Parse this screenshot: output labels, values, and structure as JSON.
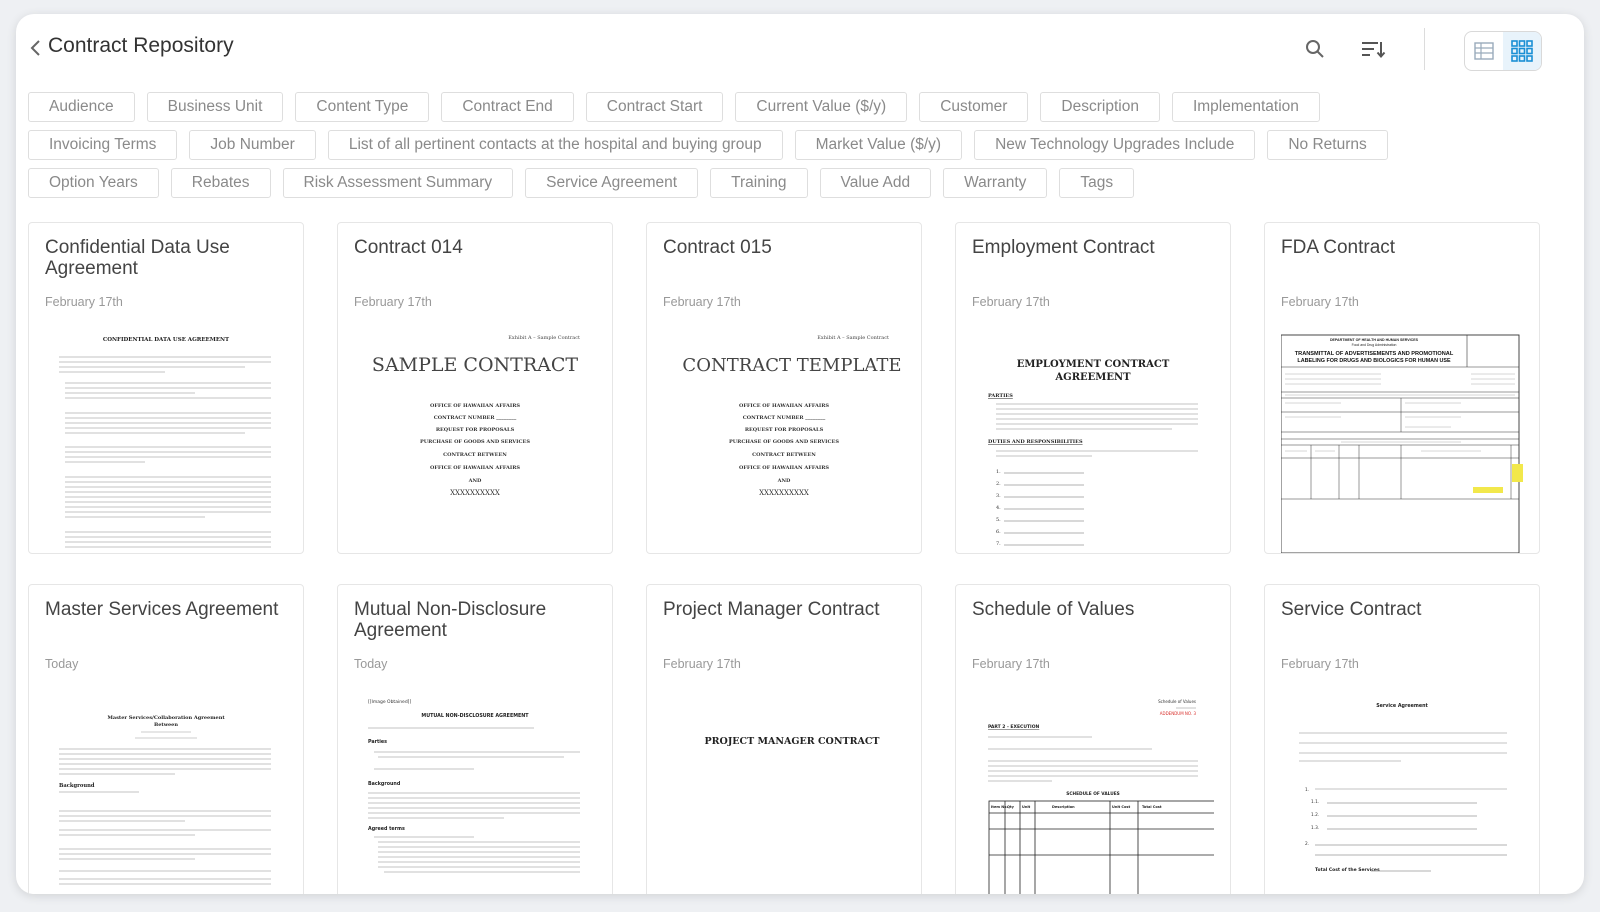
{
  "header": {
    "title": "Contract Repository",
    "icons": [
      "back-chevron-icon",
      "search-icon",
      "sort-icon",
      "table-view-icon",
      "grid-view-icon"
    ],
    "active_view": "grid"
  },
  "filters": {
    "row1": [
      "Audience",
      "Business Unit",
      "Content Type",
      "Contract End",
      "Contract Start",
      "Current Value ($/y)",
      "Customer",
      "Description",
      "Implementation"
    ],
    "row2": [
      "Invoicing Terms",
      "Job Number",
      "List of all pertinent contacts at the hospital and buying group",
      "Market Value ($/y)",
      "New Technology Upgrades Include",
      "No Returns"
    ],
    "row3": [
      "Option Years",
      "Rebates",
      "Risk Assessment Summary",
      "Service Agreement",
      "Training",
      "Value Add",
      "Warranty",
      "Tags"
    ]
  },
  "cards": [
    {
      "title": "Confidential Data Use Agreement",
      "date": "February 17th",
      "heading": "CONFIDENTIAL DATA USE AGREEMENT"
    },
    {
      "title": "Contract 014",
      "date": "February 17th",
      "exhibit": "Exhibit A – Sample Contract",
      "heading": "SAMPLE CONTRACT",
      "lines": [
        "OFFICE OF HAWAIIAN AFFAIRS",
        "CONTRACT NUMBER ________",
        "REQUEST FOR PROPOSALS",
        "PURCHASE OF GOODS AND SERVICES",
        "CONTRACT BETWEEN",
        "OFFICE OF HAWAIIAN AFFAIRS",
        "AND",
        "XXXXXXXXXX"
      ]
    },
    {
      "title": "Contract 015",
      "date": "February 17th",
      "exhibit": "Exhibit A – Sample Contract",
      "heading": "CONTRACT TEMPLATE",
      "lines": [
        "OFFICE OF HAWAIIAN AFFAIRS",
        "CONTRACT NUMBER ________",
        "REQUEST FOR PROPOSALS",
        "PURCHASE OF GOODS AND SERVICES",
        "CONTRACT BETWEEN",
        "OFFICE OF HAWAIIAN AFFAIRS",
        "AND",
        "XXXXXXXXXX"
      ]
    },
    {
      "title": "Employment Contract",
      "date": "February 17th",
      "heading1": "EMPLOYMENT CONTRACT",
      "heading2": "AGREEMENT",
      "section1": "PARTIES",
      "section2": "DUTIES AND RESPONSIBILITIES"
    },
    {
      "title": "FDA Contract",
      "date": "February 17th",
      "dept": "DEPARTMENT OF HEALTH AND HUMAN SERVICES",
      "agency": "Food and Drug Administration",
      "heading1": "TRANSMITTAL OF ADVERTISEMENTS AND PROMOTIONAL",
      "heading2": "LABELING FOR DRUGS AND BIOLOGICS FOR HUMAN USE"
    },
    {
      "title": "Master Services Agreement",
      "date": "Today",
      "heading1": "Master Services/Collaboration Agreement",
      "heading2": "Between",
      "section1": "Background"
    },
    {
      "title": "Mutual Non-Disclosure Agreement",
      "date": "Today",
      "image_tag": "[[Image Obtained]]",
      "heading": "MUTUAL NON-DISCLOSURE AGREEMENT",
      "section1": "Parties",
      "section2": "Background",
      "section3": "Agreed terms"
    },
    {
      "title": "Project Manager Contract",
      "date": "February 17th",
      "heading": "PROJECT MANAGER CONTRACT"
    },
    {
      "title": "Schedule of Values",
      "date": "February 17th",
      "corner1": "Schedule of Values",
      "corner2": "ADDENDUM NO. 3",
      "section1": "PART 2 - EXECUTION",
      "table_title": "SCHEDULE OF VALUES",
      "table_headers": [
        "Item No.",
        "Qty",
        "Unit",
        "Description",
        "Unit Cost",
        "Total Cost"
      ]
    },
    {
      "title": "Service Contract",
      "date": "February 17th",
      "heading": "Service Agreement",
      "closing": "Total Cost of the Services"
    }
  ],
  "colors": {
    "accent": "#1a8fd4",
    "red_text": "#d9302c",
    "chip_text": "#8a8a8a",
    "chip_border": "#dedede"
  }
}
